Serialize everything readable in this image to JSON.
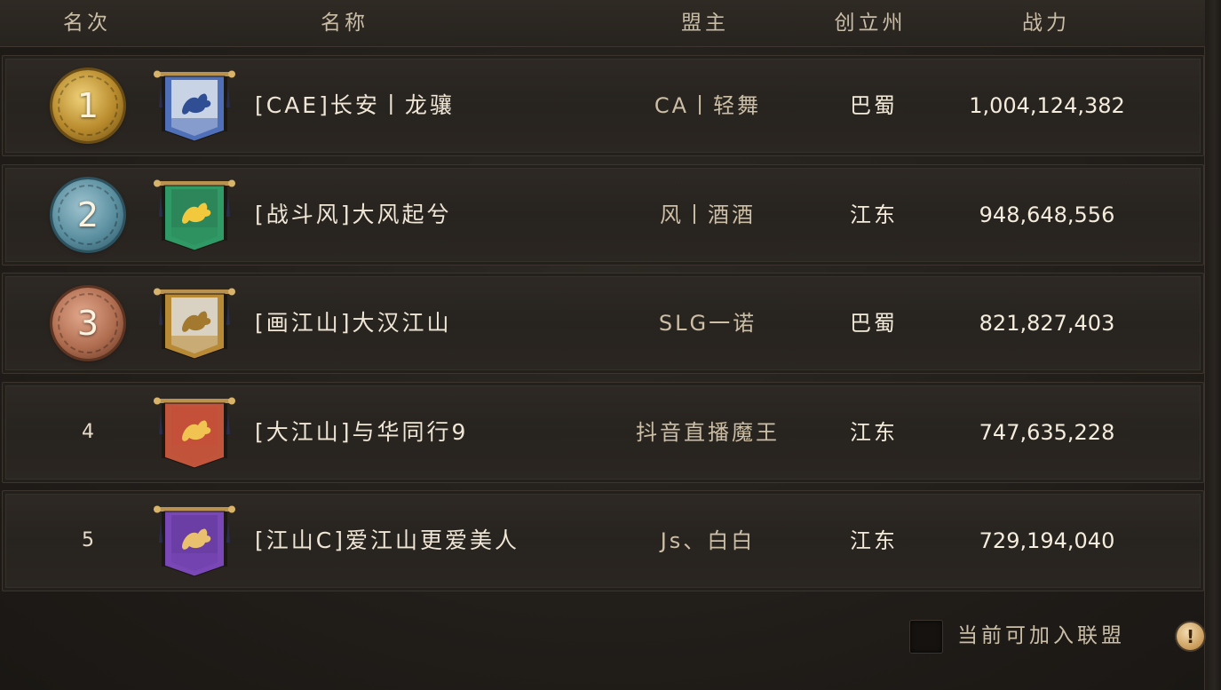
{
  "header": {
    "rank": "名次",
    "name": "名称",
    "leader": "盟主",
    "state": "创立州",
    "power": "战力"
  },
  "rows": [
    {
      "rank": "1",
      "name": "[CAE]长安丨龙骧",
      "leader": "CA丨轻舞",
      "state": "巴蜀",
      "power": "1,004,124,382",
      "medal": {
        "color1": "#f0d27a",
        "color2": "#b88a2c",
        "color3": "#6b4e16"
      },
      "banner": {
        "flag": "#4f70b8",
        "panel": "#c9d3e6",
        "emblem": "#2f4e93",
        "icon": "dragon-banner-icon"
      }
    },
    {
      "rank": "2",
      "name": "[战斗风]大风起兮",
      "leader": "风丨酒酒",
      "state": "江东",
      "power": "948,648,556",
      "medal": {
        "color1": "#9fc3cf",
        "color2": "#5a8fa0",
        "color3": "#2d5260"
      },
      "banner": {
        "flag": "#2f9a66",
        "panel": "#2c8659",
        "emblem": "#f2c93c",
        "icon": "phoenix-banner-icon"
      }
    },
    {
      "rank": "3",
      "name": "[画江山]大汉江山",
      "leader": "SLG一诺",
      "state": "巴蜀",
      "power": "821,827,403",
      "medal": {
        "color1": "#e2a88c",
        "color2": "#b06d50",
        "color3": "#5e3422"
      },
      "banner": {
        "flag": "#b98a36",
        "panel": "#d9d2c2",
        "emblem": "#a2792f",
        "icon": "dragon-banner-icon"
      }
    },
    {
      "rank": "4",
      "name": "[大江山]与华同行9",
      "leader": "抖音直播魔王",
      "state": "江东",
      "power": "747,635,228",
      "banner": {
        "flag": "#c0553c",
        "panel": "#c4503a",
        "emblem": "#f1c452",
        "icon": "dragon-banner-icon"
      }
    },
    {
      "rank": "5",
      "name": "[江山C]爱江山更爱美人",
      "leader": "Js、白白",
      "state": "江东",
      "power": "729,194,040",
      "banner": {
        "flag": "#7a48b6",
        "panel": "#6b3ea6",
        "emblem": "#e9c06d",
        "icon": "deer-banner-icon"
      }
    }
  ],
  "footer": {
    "joinable_label": "当前可加入联盟",
    "joinable_checked": false,
    "info_glyph": "!"
  }
}
